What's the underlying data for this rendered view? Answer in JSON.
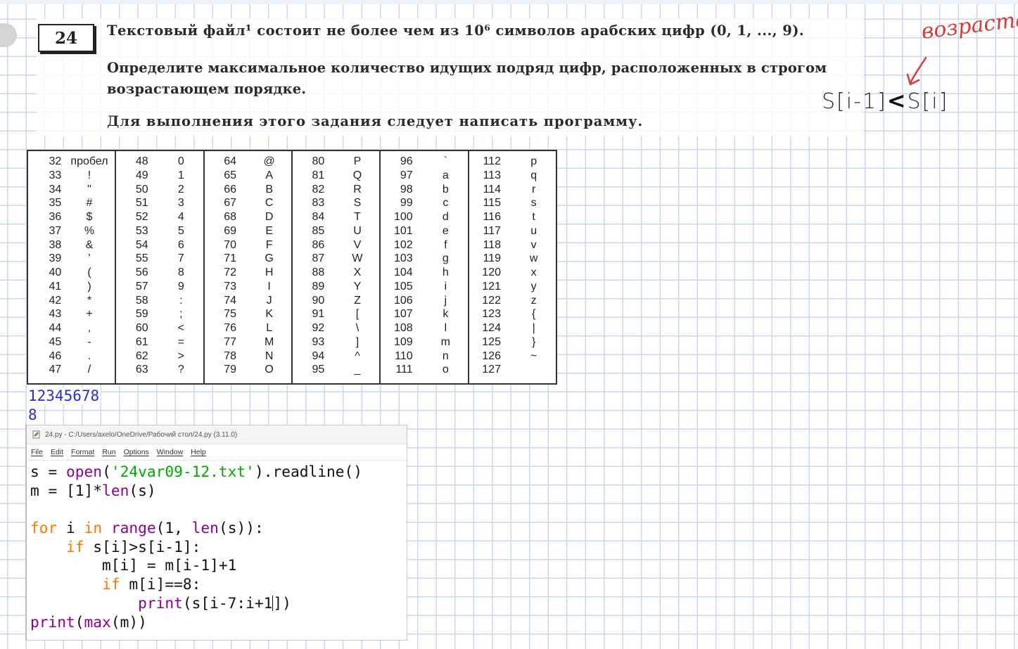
{
  "task": {
    "number": "24",
    "line1": "Текстовый файл¹ состоит не более чем из 10⁶ символов арабских цифр (0, 1, ..., 9).",
    "line2a": "Определите максимальное количество идущих подряд цифр, расположенных в строгом",
    "line2b": "возрастающем порядке.",
    "line3": "Для выполнения этого задания следует написать программу."
  },
  "annotations": {
    "word": "возраста",
    "formula_left": "S[i-1]",
    "formula_op": "<",
    "formula_right": "S[i]",
    "arrow_color": "#d93b3b"
  },
  "ascii_table": {
    "columns": [
      [
        [
          "32",
          "пробел"
        ],
        [
          "33",
          "!"
        ],
        [
          "34",
          "\""
        ],
        [
          "35",
          "#"
        ],
        [
          "36",
          "$"
        ],
        [
          "37",
          "%"
        ],
        [
          "38",
          "&"
        ],
        [
          "39",
          "'"
        ],
        [
          "40",
          "("
        ],
        [
          "41",
          ")"
        ],
        [
          "42",
          "*"
        ],
        [
          "43",
          "+"
        ],
        [
          "44",
          ","
        ],
        [
          "45",
          "-"
        ],
        [
          "46",
          "."
        ],
        [
          "47",
          "/"
        ]
      ],
      [
        [
          "48",
          "0"
        ],
        [
          "49",
          "1"
        ],
        [
          "50",
          "2"
        ],
        [
          "51",
          "3"
        ],
        [
          "52",
          "4"
        ],
        [
          "53",
          "5"
        ],
        [
          "54",
          "6"
        ],
        [
          "55",
          "7"
        ],
        [
          "56",
          "8"
        ],
        [
          "57",
          "9"
        ],
        [
          "58",
          ":"
        ],
        [
          "59",
          ";"
        ],
        [
          "60",
          "<"
        ],
        [
          "61",
          "="
        ],
        [
          "62",
          ">"
        ],
        [
          "63",
          "?"
        ]
      ],
      [
        [
          "64",
          "@"
        ],
        [
          "65",
          "A"
        ],
        [
          "66",
          "B"
        ],
        [
          "67",
          "C"
        ],
        [
          "68",
          "D"
        ],
        [
          "69",
          "E"
        ],
        [
          "70",
          "F"
        ],
        [
          "71",
          "G"
        ],
        [
          "72",
          "H"
        ],
        [
          "73",
          "I"
        ],
        [
          "74",
          "J"
        ],
        [
          "75",
          "K"
        ],
        [
          "76",
          "L"
        ],
        [
          "77",
          "M"
        ],
        [
          "78",
          "N"
        ],
        [
          "79",
          "O"
        ]
      ],
      [
        [
          "80",
          "P"
        ],
        [
          "81",
          "Q"
        ],
        [
          "82",
          "R"
        ],
        [
          "83",
          "S"
        ],
        [
          "84",
          "T"
        ],
        [
          "85",
          "U"
        ],
        [
          "86",
          "V"
        ],
        [
          "87",
          "W"
        ],
        [
          "88",
          "X"
        ],
        [
          "89",
          "Y"
        ],
        [
          "90",
          "Z"
        ],
        [
          "91",
          "["
        ],
        [
          "92",
          "\\"
        ],
        [
          "93",
          "]"
        ],
        [
          "94",
          "^"
        ],
        [
          "95",
          "_"
        ]
      ],
      [
        [
          "96",
          "`"
        ],
        [
          "97",
          "a"
        ],
        [
          "98",
          "b"
        ],
        [
          "99",
          "c"
        ],
        [
          "100",
          "d"
        ],
        [
          "101",
          "e"
        ],
        [
          "102",
          "f"
        ],
        [
          "103",
          "g"
        ],
        [
          "104",
          "h"
        ],
        [
          "105",
          "i"
        ],
        [
          "106",
          "j"
        ],
        [
          "107",
          "k"
        ],
        [
          "108",
          "l"
        ],
        [
          "109",
          "m"
        ],
        [
          "110",
          "n"
        ],
        [
          "111",
          "o"
        ]
      ],
      [
        [
          "112",
          "p"
        ],
        [
          "113",
          "q"
        ],
        [
          "114",
          "r"
        ],
        [
          "115",
          "s"
        ],
        [
          "116",
          "t"
        ],
        [
          "117",
          "u"
        ],
        [
          "118",
          "v"
        ],
        [
          "119",
          "w"
        ],
        [
          "120",
          "x"
        ],
        [
          "121",
          "y"
        ],
        [
          "122",
          "z"
        ],
        [
          "123",
          "{"
        ],
        [
          "124",
          "|"
        ],
        [
          "125",
          "}"
        ],
        [
          "126",
          "~"
        ],
        [
          "127",
          ""
        ]
      ]
    ]
  },
  "output": {
    "line1": "12345678",
    "line2": "8"
  },
  "editor": {
    "title": "24.py - C:/Users/axelo/OneDrive/Рабочий стол/24.py (3.11.0)",
    "menu": [
      "File",
      "Edit",
      "Format",
      "Run",
      "Options",
      "Window",
      "Help"
    ],
    "code_lines": [
      [
        [
          "",
          "s = "
        ],
        [
          "bi",
          "open"
        ],
        [
          "",
          "("
        ],
        [
          "str",
          "'24var09-12.txt'"
        ],
        [
          "",
          ").readline()"
        ]
      ],
      [
        [
          "",
          "m = [1]*"
        ],
        [
          "bi",
          "len"
        ],
        [
          "",
          "(s)"
        ]
      ],
      [
        [
          "",
          ""
        ]
      ],
      [
        [
          "kw",
          "for"
        ],
        [
          "",
          " i "
        ],
        [
          "kw",
          "in"
        ],
        [
          "",
          " "
        ],
        [
          "bi",
          "range"
        ],
        [
          "",
          "(1, "
        ],
        [
          "bi",
          "len"
        ],
        [
          "",
          "(s)):"
        ]
      ],
      [
        [
          "",
          "    "
        ],
        [
          "kw",
          "if"
        ],
        [
          "",
          " s[i]>s[i-1]:"
        ]
      ],
      [
        [
          "",
          "        m[i] = m[i-1]+1"
        ]
      ],
      [
        [
          "",
          "        "
        ],
        [
          "kw",
          "if"
        ],
        [
          "",
          " m[i]==8:"
        ]
      ],
      [
        [
          "",
          "            "
        ],
        [
          "bi",
          "print"
        ],
        [
          "",
          "(s[i-7:i+1"
        ],
        [
          "cursor",
          ""
        ],
        [
          "",
          "])"
        ]
      ],
      [
        [
          "bi",
          "print"
        ],
        [
          "",
          "("
        ],
        [
          "bi",
          "max"
        ],
        [
          "",
          "(m))"
        ]
      ]
    ]
  }
}
